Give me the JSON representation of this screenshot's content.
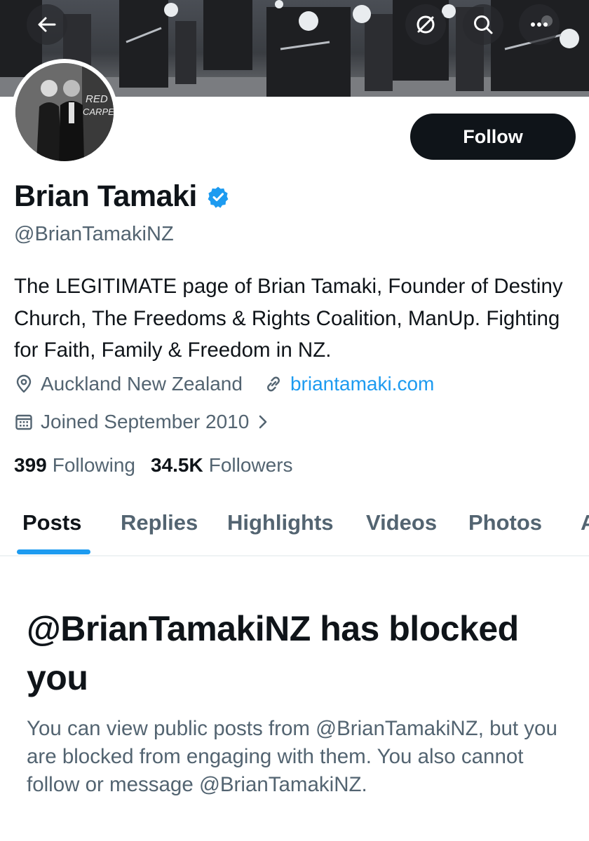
{
  "profile": {
    "name": "Brian Tamaki",
    "handle": "@BrianTamakiNZ",
    "bio": "The LEGITIMATE page of Brian Tamaki, Founder of Destiny Church, The Freedoms & Rights Coalition, ManUp. Fighting for Faith, Family & Freedom in NZ.",
    "location": "Auckland New Zealand",
    "website": "briantamaki.com",
    "joined": "Joined September 2010",
    "following_count": "399",
    "following_label": "Following",
    "followers_count": "34.5K",
    "followers_label": "Followers",
    "avatar_sign_text": "RED CARPET"
  },
  "actions": {
    "follow_label": "Follow"
  },
  "header_icons": [
    "back-arrow-icon",
    "grok-icon",
    "search-icon",
    "more-icon"
  ],
  "tabs": [
    {
      "label": "Posts",
      "active": true
    },
    {
      "label": "Replies",
      "active": false
    },
    {
      "label": "Highlights",
      "active": false
    },
    {
      "label": "Videos",
      "active": false
    },
    {
      "label": "Photos",
      "active": false
    },
    {
      "label": "A",
      "active": false
    }
  ],
  "blocked": {
    "title": "@BrianTamakiNZ has blocked you",
    "description": "You can view public posts from @BrianTamakiNZ, but you are blocked from engaging with them. You also cannot follow or message @BrianTamakiNZ."
  },
  "colors": {
    "accent": "#1d9bf0",
    "text_primary": "#0f1419",
    "text_secondary": "#536471",
    "button_dark": "#0f1419"
  }
}
